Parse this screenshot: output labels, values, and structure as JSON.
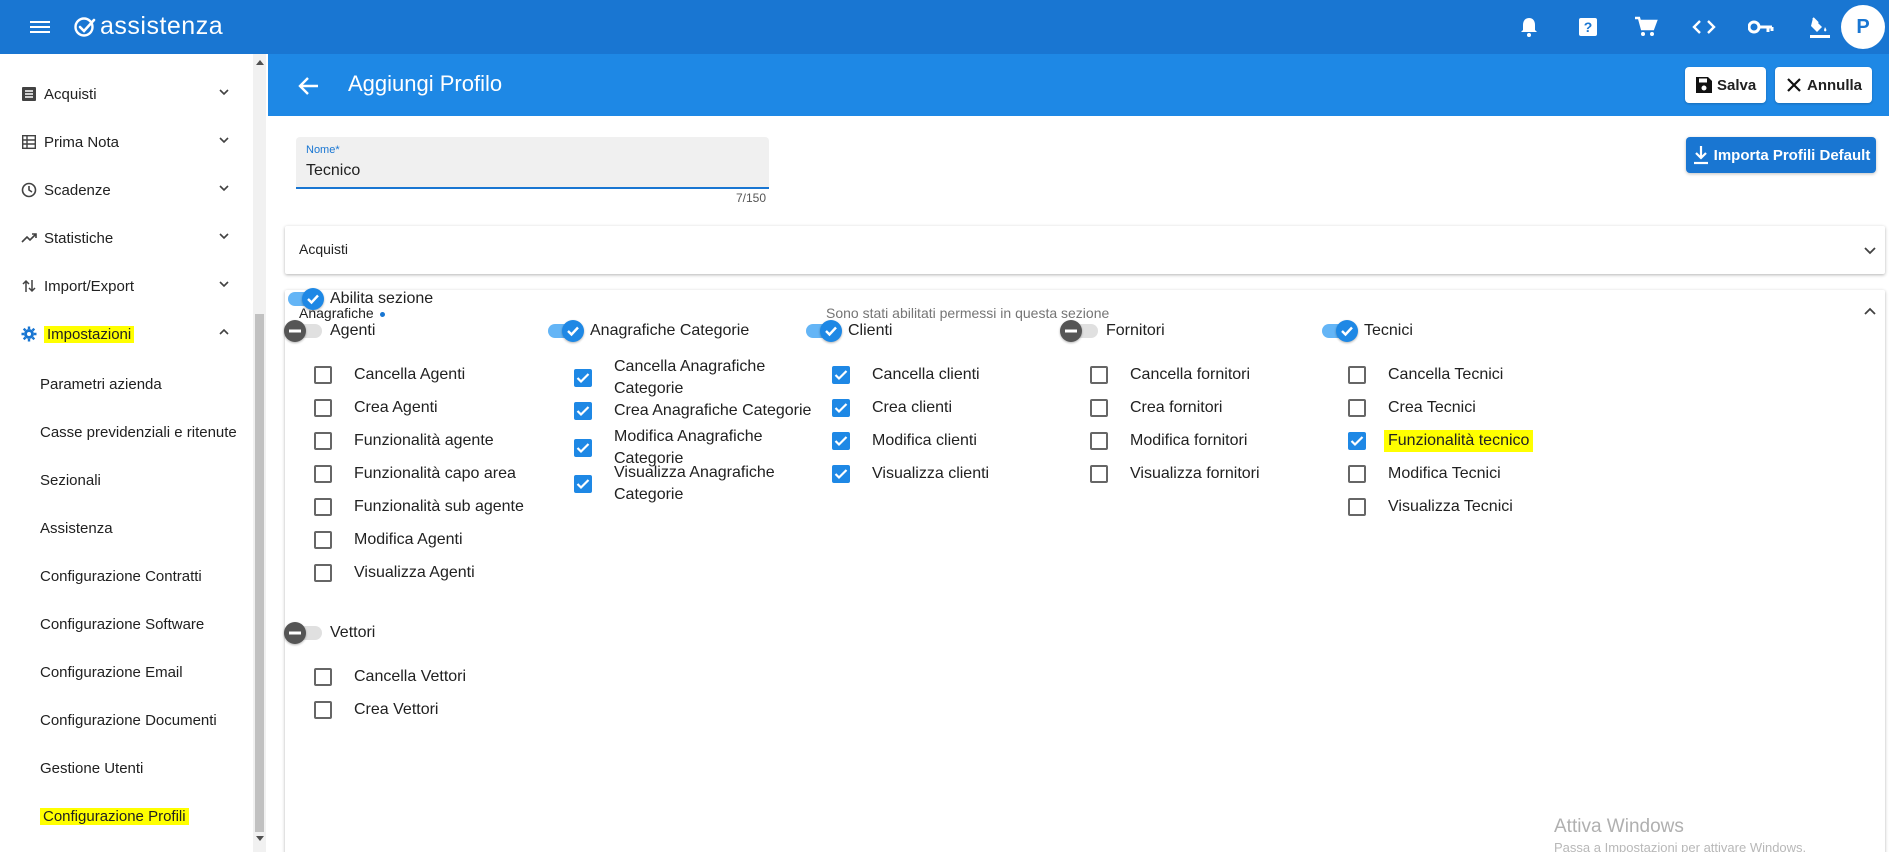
{
  "app": {
    "logo_text": "assistenza",
    "avatar_letter": "P"
  },
  "topbar": {
    "icons": [
      "bell-icon",
      "help-icon",
      "cart-icon",
      "code-icon",
      "key-icon",
      "paint-bucket-icon"
    ]
  },
  "sidebar": {
    "items": [
      {
        "label": "Acquisti",
        "icon": "list-icon"
      },
      {
        "label": "Prima Nota",
        "icon": "table-icon"
      },
      {
        "label": "Scadenze",
        "icon": "clock-icon"
      },
      {
        "label": "Statistiche",
        "icon": "trending-up-icon"
      },
      {
        "label": "Import/Export",
        "icon": "import-export-icon"
      },
      {
        "label": "Impostazioni",
        "icon": "gear-icon"
      }
    ],
    "subitems": [
      {
        "label": "Parametri azienda"
      },
      {
        "label": "Casse previdenziali e ritenute"
      },
      {
        "label": "Sezionali"
      },
      {
        "label": "Assistenza"
      },
      {
        "label": "Configurazione Contratti"
      },
      {
        "label": "Configurazione Software"
      },
      {
        "label": "Configurazione Email"
      },
      {
        "label": "Configurazione Documenti"
      },
      {
        "label": "Gestione Utenti"
      },
      {
        "label": "Configurazione Profili"
      }
    ]
  },
  "header": {
    "title": "Aggiungi Profilo",
    "save_label": "Salva",
    "cancel_label": "Annulla"
  },
  "form": {
    "name_label": "Nome*",
    "name_value": "Tecnico",
    "counter": "7/150",
    "import_label": "Importa Profili Default"
  },
  "panels": {
    "acquisti_title": "Acquisti",
    "anagrafiche_title": "Anagrafiche",
    "anagrafiche_note": "Sono stati abilitati permessi in questa sezione",
    "enable_section_label": "Abilita sezione"
  },
  "groups": [
    {
      "name": "Agenti",
      "enabled": false,
      "perms": [
        {
          "label": "Cancella Agenti",
          "checked": false
        },
        {
          "label": "Crea Agenti",
          "checked": false
        },
        {
          "label": "Funzionalità agente",
          "checked": false
        },
        {
          "label": "Funzionalità capo area",
          "checked": false
        },
        {
          "label": "Funzionalità sub agente",
          "checked": false
        },
        {
          "label": "Modifica Agenti",
          "checked": false
        },
        {
          "label": "Visualizza Agenti",
          "checked": false
        }
      ]
    },
    {
      "name": "Anagrafiche Categorie",
      "enabled": true,
      "perms": [
        {
          "label": "Cancella Anagrafiche Categorie",
          "checked": true
        },
        {
          "label": "Crea Anagrafiche Categorie",
          "checked": true
        },
        {
          "label": "Modifica Anagrafiche Categorie",
          "checked": true
        },
        {
          "label": "Visualizza Anagrafiche Categorie",
          "checked": true
        }
      ]
    },
    {
      "name": "Clienti",
      "enabled": true,
      "perms": [
        {
          "label": "Cancella clienti",
          "checked": true
        },
        {
          "label": "Crea clienti",
          "checked": true
        },
        {
          "label": "Modifica clienti",
          "checked": true
        },
        {
          "label": "Visualizza clienti",
          "checked": true
        }
      ]
    },
    {
      "name": "Fornitori",
      "enabled": false,
      "perms": [
        {
          "label": "Cancella fornitori",
          "checked": false
        },
        {
          "label": "Crea fornitori",
          "checked": false
        },
        {
          "label": "Modifica fornitori",
          "checked": false
        },
        {
          "label": "Visualizza fornitori",
          "checked": false
        }
      ]
    },
    {
      "name": "Tecnici",
      "enabled": true,
      "perms": [
        {
          "label": "Cancella Tecnici",
          "checked": false
        },
        {
          "label": "Crea Tecnici",
          "checked": false
        },
        {
          "label": "Funzionalità tecnico",
          "checked": true
        },
        {
          "label": "Modifica Tecnici",
          "checked": false
        },
        {
          "label": "Visualizza Tecnici",
          "checked": false
        }
      ]
    },
    {
      "name": "Vettori",
      "enabled": false,
      "perms": [
        {
          "label": "Cancella Vettori",
          "checked": false
        },
        {
          "label": "Crea Vettori",
          "checked": false
        }
      ]
    }
  ],
  "watermark": {
    "title": "Attiva Windows",
    "subtitle": "Passa a Impostazioni per attivare Windows."
  },
  "colors": {
    "primary": "#1976d2",
    "header": "#1e88e5",
    "highlight": "#ffff00"
  }
}
